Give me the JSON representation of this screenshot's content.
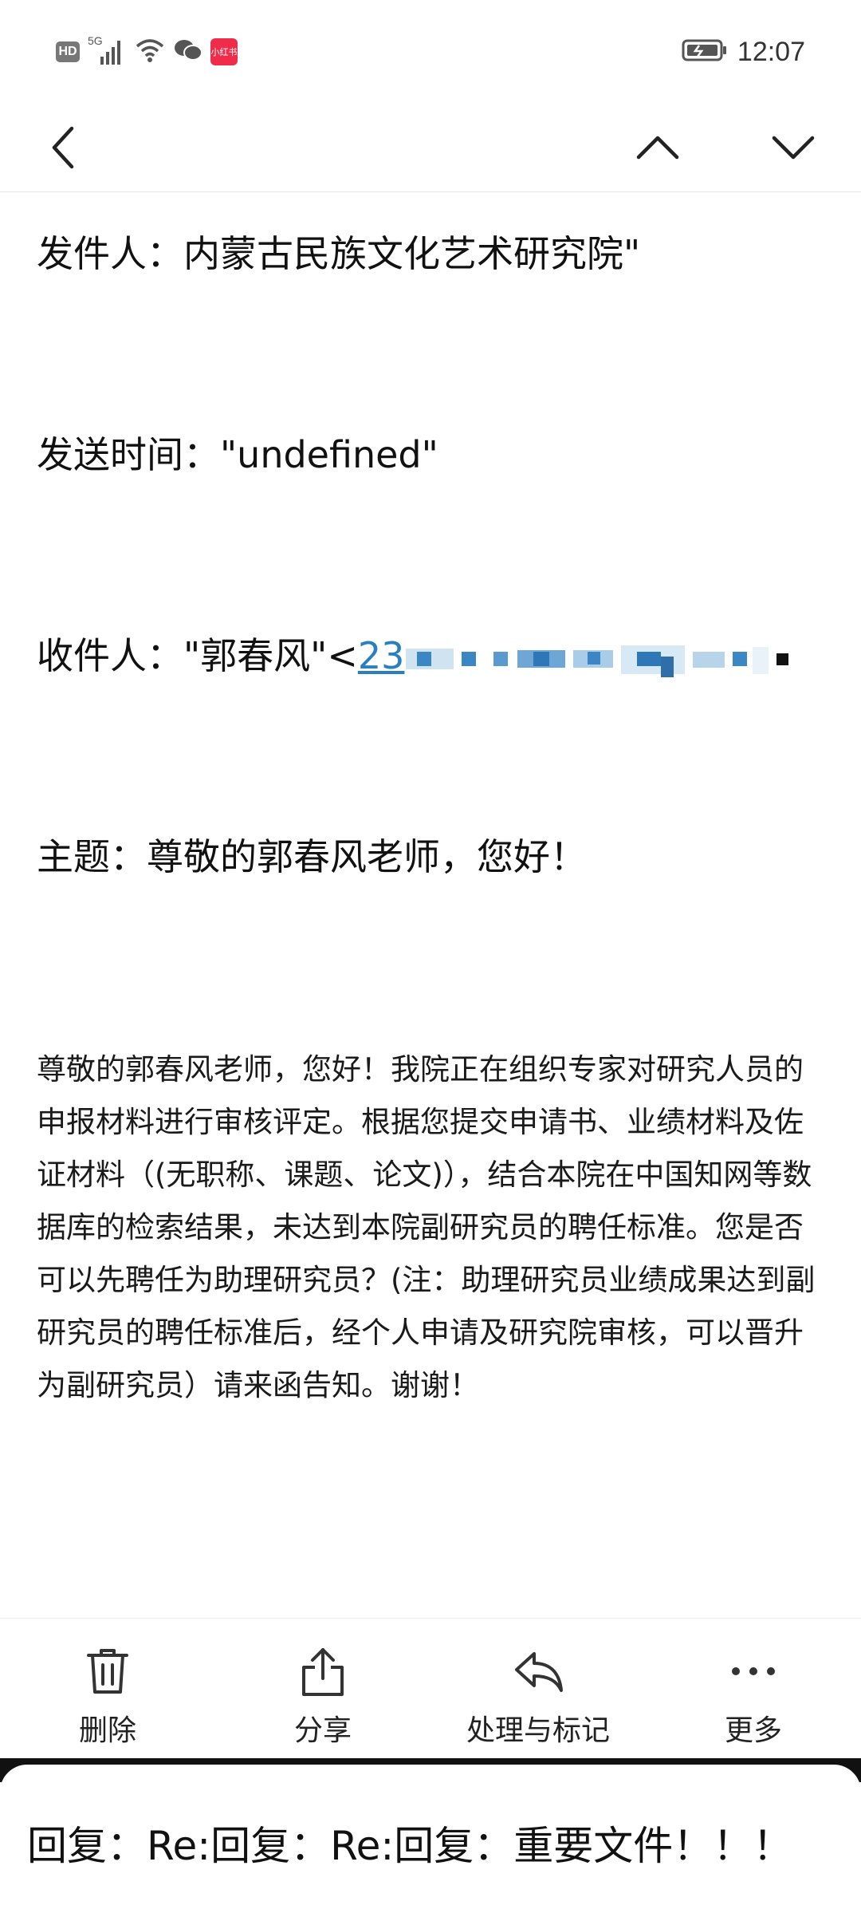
{
  "status_bar": {
    "hd": "HD",
    "network": "5G",
    "app_badge": "小红书",
    "time": "12:07"
  },
  "nav": {
    "back_icon": "chevron-left-icon",
    "prev_icon": "chevron-up-icon",
    "next_icon": "chevron-down-icon"
  },
  "email": {
    "sender_label": "发件人：",
    "sender_value": "内蒙古民族文化艺术研究院\"",
    "time_label": "发送时间：",
    "time_value": "\"undefined\"",
    "to_label": "收件人：",
    "to_name": "\"郭春风\"<",
    "to_email_visible": "23",
    "subject_label": "主题：",
    "subject_value": "尊敬的郭春风老师，您好！",
    "body": "尊敬的郭春风老师，您好！我院正在组织专家对研究人员的申报材料进行审核评定。根据您提交申请书、业绩材料及佐证材料（(无职称、课题、论文)），结合本院在中国知网等数据库的检索结果，未达到本院副研究员的聘任标准。您是否可以先聘任为助理研究员？(注：助理研究员业绩成果达到副研究员的聘任标准后，经个人申请及研究院审核，可以晋升为副研究员）请来函告知。谢谢！"
  },
  "toolbar": {
    "delete_label": "删除",
    "share_label": "分享",
    "process_label": "处理与标记",
    "more_label": "更多"
  },
  "reply_sheet": {
    "title": "回复：Re:回复：Re:回复：重要文件！！！"
  },
  "colors": {
    "link": "#2a7fc0",
    "text": "#111111",
    "badge": "#ef2d4a"
  }
}
